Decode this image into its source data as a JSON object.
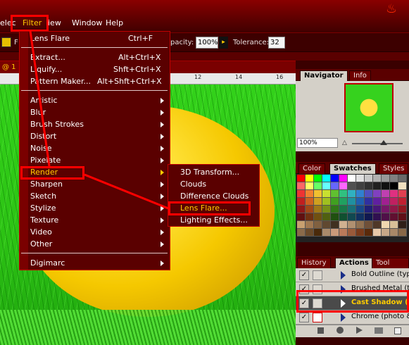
{
  "menubar": {
    "items": [
      "elect",
      "Filter",
      "View",
      "Window",
      "Help"
    ],
    "visible": [
      "elec",
      "Filter",
      "iew",
      "Window",
      "Help"
    ]
  },
  "options": {
    "opacity_label": "pacity:",
    "opacity_value": "100%",
    "tolerance_label": "Tolerance:",
    "tolerance_value": "32",
    "f_label": "F"
  },
  "document": {
    "title": "@ 1",
    "ruler_ticks": [
      "12",
      "14",
      "16"
    ]
  },
  "filter_menu": {
    "top_items": [
      {
        "label": "Lens Flare",
        "shortcut": "Ctrl+F"
      }
    ],
    "group2": [
      {
        "label": "Extract...",
        "shortcut": "Alt+Ctrl+X"
      },
      {
        "label": "Liquify...",
        "shortcut": "Shft+Ctrl+X"
      },
      {
        "label": "Pattern Maker...",
        "shortcut": "Alt+Shft+Ctrl+X"
      }
    ],
    "submenus": [
      "Artistic",
      "Blur",
      "Brush Strokes",
      "Distort",
      "Noise",
      "Pixelate",
      "Render",
      "Sharpen",
      "Sketch",
      "Stylize",
      "Texture",
      "Video",
      "Other"
    ],
    "bottom": [
      "Digimarc"
    ]
  },
  "render_submenu": [
    "3D Transform...",
    "Clouds",
    "Difference Clouds",
    "Lens Flare...",
    "Lighting Effects..."
  ],
  "panels": {
    "nav_tabs": [
      "Navigator",
      "Info"
    ],
    "nav_zoom": "100%",
    "swatch_tabs": [
      "Color",
      "Swatches",
      "Styles"
    ],
    "actions_tabs": [
      "History",
      "Actions",
      "Tool Pres"
    ],
    "actions": [
      {
        "label": "Bold Outline (typ",
        "checked": true
      },
      {
        "label": "Brushed Metal (t",
        "checked": true
      },
      {
        "label": "Cast Shadow (",
        "checked": true,
        "highlight": true
      },
      {
        "label": "Chrome (photo &",
        "checked": true
      }
    ]
  },
  "colors": {
    "highlight": "#ff0000",
    "menu_bg": "#5a0000",
    "accent_yellow": "#ffcc00"
  }
}
